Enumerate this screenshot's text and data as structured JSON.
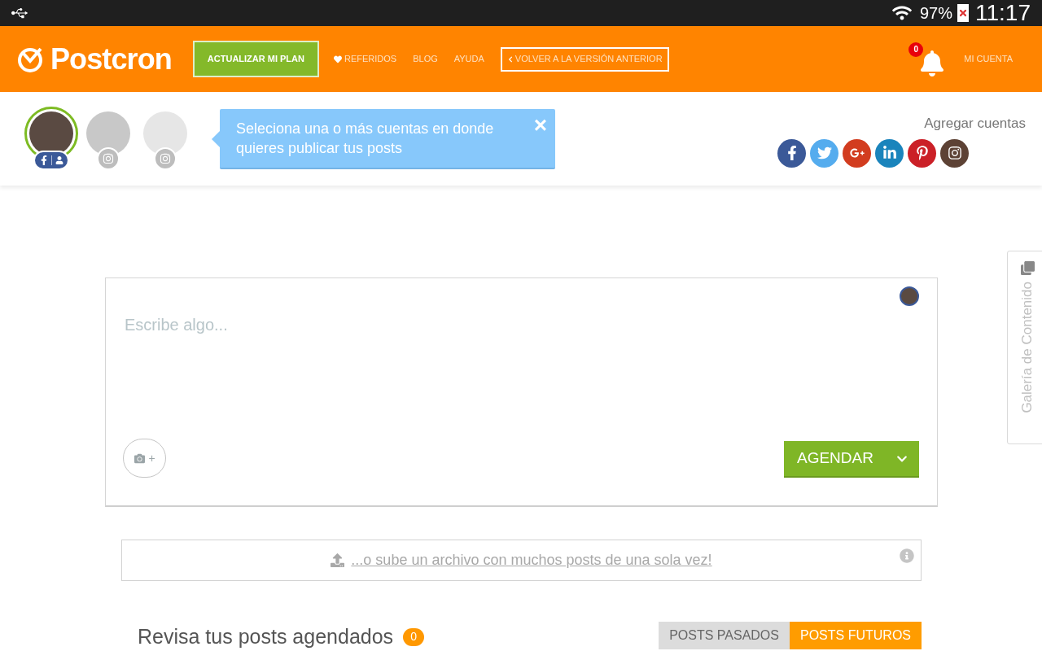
{
  "status_bar": {
    "battery": "97%",
    "time": "11:17"
  },
  "header": {
    "logo": "Postcron",
    "upgrade_button": "ACTUALIZAR MI PLAN",
    "links": [
      {
        "label": "REFERIDOS",
        "kind": "heart"
      },
      {
        "label": "BLOG",
        "kind": "plain"
      },
      {
        "label": "AYUDA",
        "kind": "plain"
      }
    ],
    "back_button": "VOLVER A LA VERSIÓN ANTERIOR",
    "notifications": "0",
    "account": "MI CUENTA"
  },
  "accounts": [
    {
      "kind": "facebook",
      "selected": true
    },
    {
      "kind": "instagram",
      "selected": false
    },
    {
      "kind": "instagram",
      "selected": false
    }
  ],
  "tooltip": {
    "text": "Seleciona una o más cuentas en donde quieres publicar tus posts",
    "close": "×"
  },
  "add_accounts": {
    "label": "Agregar cuentas",
    "networks": [
      {
        "kind": "facebook",
        "color": "#3b5998"
      },
      {
        "kind": "twitter",
        "color": "#55acee"
      },
      {
        "kind": "googleplus",
        "color": "#d23c1f"
      },
      {
        "kind": "linkedin",
        "color": "#1a84bc"
      },
      {
        "kind": "pinterest",
        "color": "#cb2027"
      },
      {
        "kind": "instagram",
        "color": "#5d4235"
      }
    ]
  },
  "composer": {
    "placeholder": "Escribe algo...",
    "photo_plus": "+",
    "schedule_button": "AGENDAR"
  },
  "upload_link": "...o sube un archivo con muchos posts de una sola vez!",
  "gallery_tab": "Galería de Contenido",
  "scheduled": {
    "title": "Revisa tus posts agendados",
    "count": "0",
    "tabs": [
      {
        "label": "POSTS PASADOS",
        "selected": false
      },
      {
        "label": "POSTS FUTUROS",
        "selected": true
      }
    ]
  }
}
